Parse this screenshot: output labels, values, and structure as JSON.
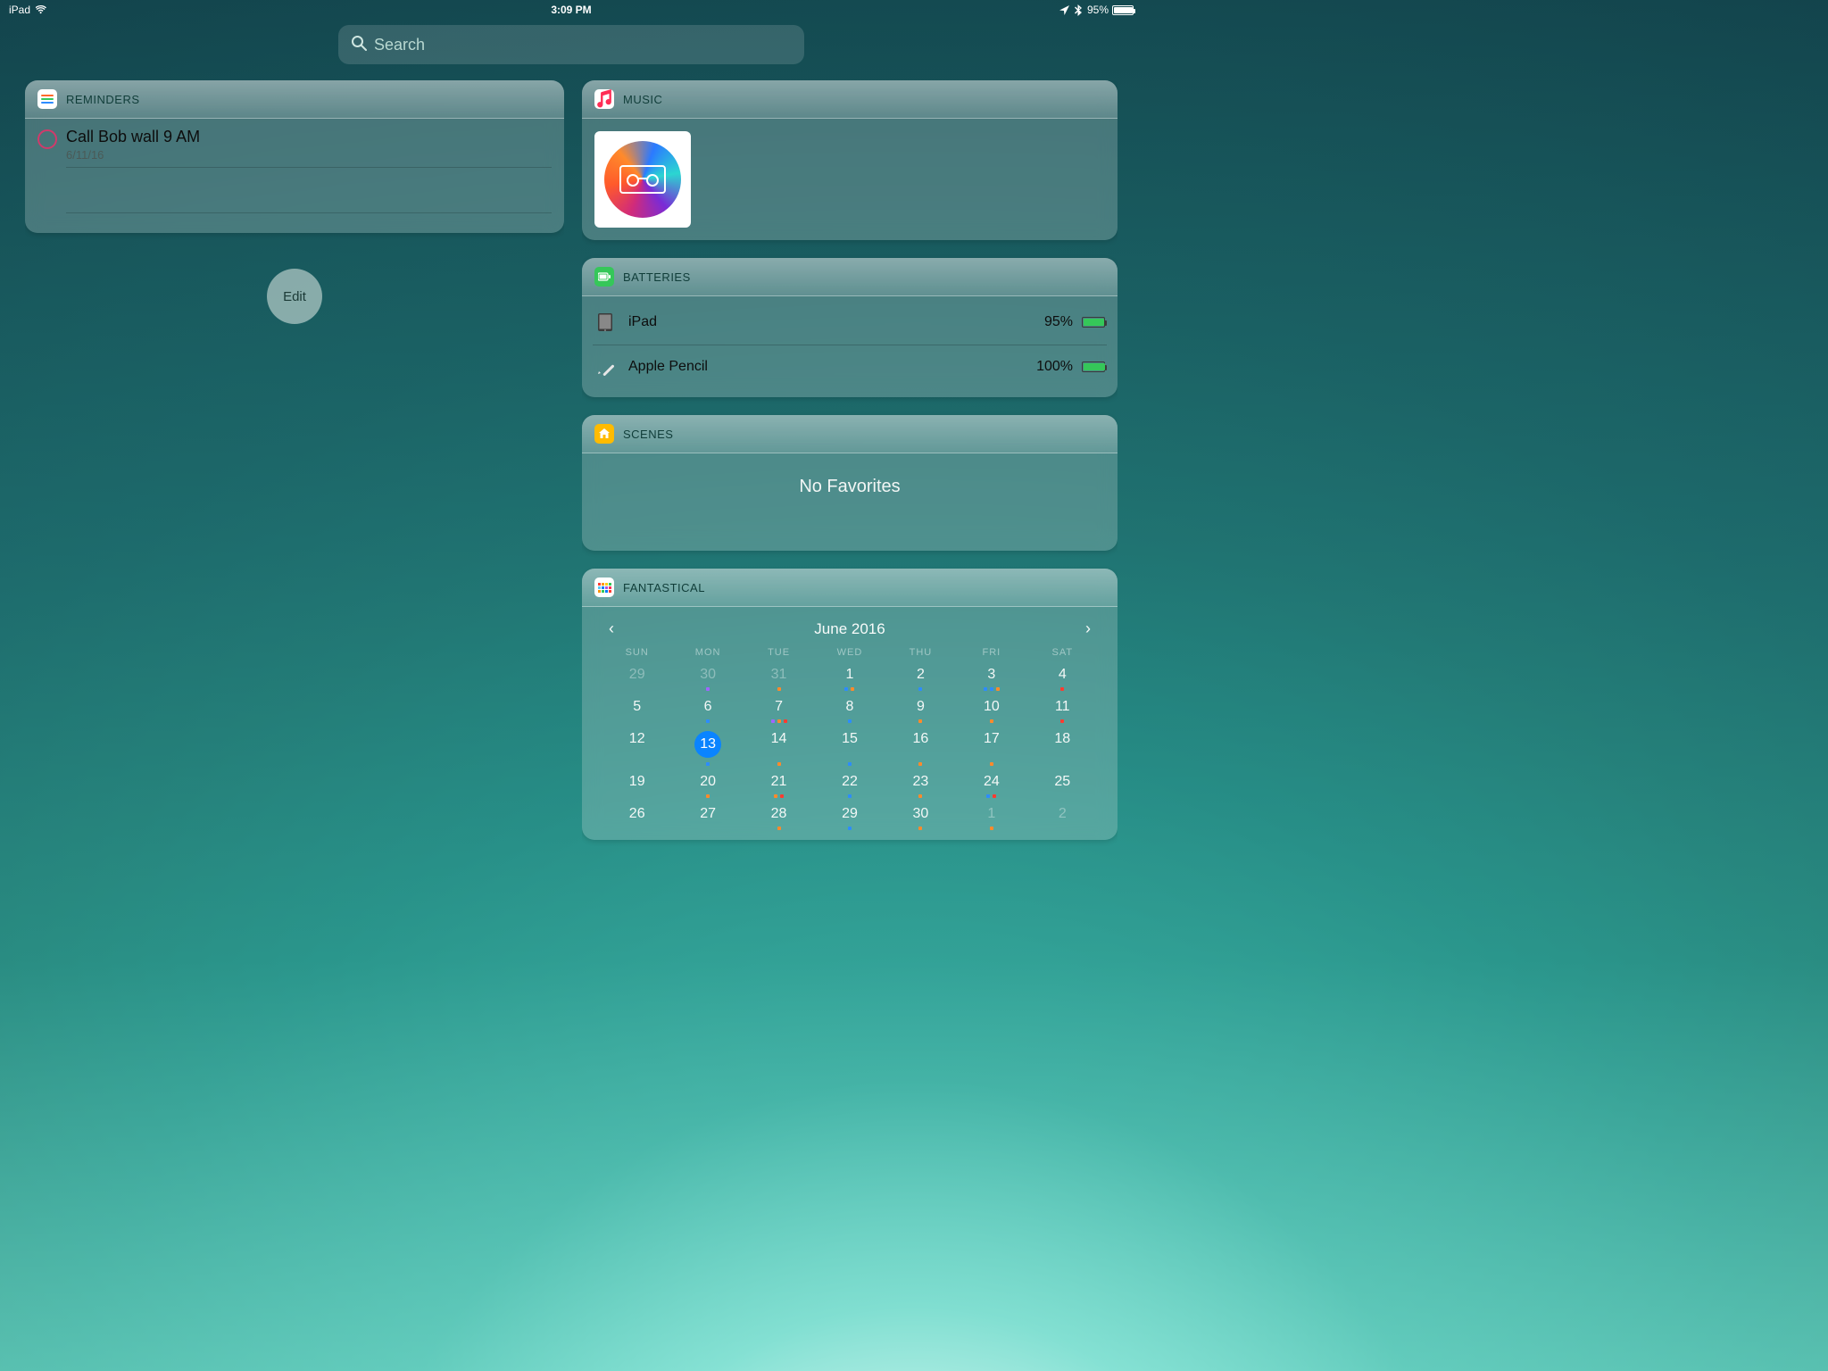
{
  "status": {
    "device": "iPad",
    "time": "3:09 PM",
    "battery_pct": "95%",
    "battery_fill": 95
  },
  "search": {
    "placeholder": "Search"
  },
  "reminders": {
    "title": "REMINDERS",
    "item_title": "Call Bob wall 9 AM",
    "item_date": "6/11/16"
  },
  "edit_label": "Edit",
  "music": {
    "title": "MUSIC"
  },
  "batteries": {
    "title": "BATTERIES",
    "rows": [
      {
        "name": "iPad",
        "pct": "95%",
        "fill": 95
      },
      {
        "name": "Apple Pencil",
        "pct": "100%",
        "fill": 100
      }
    ]
  },
  "scenes": {
    "title": "SCENES",
    "empty": "No Favorites"
  },
  "fantastical": {
    "title": "FANTASTICAL",
    "month": "June 2016",
    "dow": [
      "SUN",
      "MON",
      "TUE",
      "WED",
      "THU",
      "FRI",
      "SAT"
    ],
    "days": [
      {
        "n": "29",
        "g": true,
        "dots": []
      },
      {
        "n": "30",
        "g": true,
        "dots": [
          "purple"
        ]
      },
      {
        "n": "31",
        "g": true,
        "dots": [
          "orange"
        ]
      },
      {
        "n": "1",
        "dots": [
          "blue",
          "orange"
        ]
      },
      {
        "n": "2",
        "dots": [
          "blue"
        ]
      },
      {
        "n": "3",
        "dots": [
          "blue",
          "blue",
          "orange"
        ]
      },
      {
        "n": "4",
        "dots": [
          "red"
        ]
      },
      {
        "n": "5",
        "dots": []
      },
      {
        "n": "6",
        "dots": [
          "blue"
        ]
      },
      {
        "n": "7",
        "dots": [
          "purple",
          "orange",
          "red"
        ]
      },
      {
        "n": "8",
        "dots": [
          "blue"
        ]
      },
      {
        "n": "9",
        "dots": [
          "orange"
        ]
      },
      {
        "n": "10",
        "dots": [
          "orange"
        ]
      },
      {
        "n": "11",
        "dots": [
          "red"
        ]
      },
      {
        "n": "12",
        "dots": []
      },
      {
        "n": "13",
        "today": true,
        "dots": [
          "blue"
        ]
      },
      {
        "n": "14",
        "dots": [
          "orange"
        ]
      },
      {
        "n": "15",
        "dots": [
          "blue"
        ]
      },
      {
        "n": "16",
        "dots": [
          "orange"
        ]
      },
      {
        "n": "17",
        "dots": [
          "orange"
        ]
      },
      {
        "n": "18",
        "dots": []
      },
      {
        "n": "19",
        "dots": []
      },
      {
        "n": "20",
        "dots": [
          "orange"
        ]
      },
      {
        "n": "21",
        "dots": [
          "orange",
          "red"
        ]
      },
      {
        "n": "22",
        "dots": [
          "blue"
        ]
      },
      {
        "n": "23",
        "dots": [
          "orange"
        ]
      },
      {
        "n": "24",
        "dots": [
          "blue",
          "red"
        ]
      },
      {
        "n": "25",
        "dots": []
      },
      {
        "n": "26",
        "dots": []
      },
      {
        "n": "27",
        "dots": []
      },
      {
        "n": "28",
        "dots": [
          "orange"
        ]
      },
      {
        "n": "29",
        "dots": [
          "blue"
        ]
      },
      {
        "n": "30",
        "dots": [
          "orange"
        ]
      },
      {
        "n": "1",
        "g": true,
        "dots": [
          "orange"
        ]
      },
      {
        "n": "2",
        "g": true,
        "dots": []
      }
    ]
  }
}
